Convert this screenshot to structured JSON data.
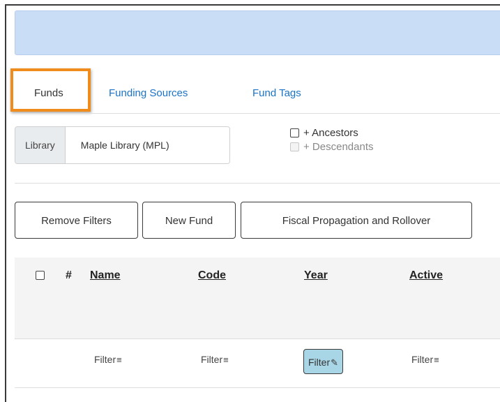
{
  "tabs": [
    {
      "label": "Funds"
    },
    {
      "label": "Funding Sources"
    },
    {
      "label": "Fund Tags"
    }
  ],
  "library_selector": {
    "label": "Library",
    "value": "Maple Library (MPL)",
    "ancestors_label": "+ Ancestors",
    "descendants_label": "+ Descendants"
  },
  "actions": {
    "remove_filters": "Remove Filters",
    "new_fund": "New Fund",
    "fiscal": "Fiscal Propagation and Rollover"
  },
  "grid": {
    "columns": {
      "row_number": "#",
      "name": "Name",
      "code": "Code",
      "year": "Year",
      "active": "Active"
    },
    "filters": {
      "name": "Filter",
      "code": "Filter",
      "year": "Filter",
      "active": "Filter"
    }
  },
  "colors": {
    "banner": "#c9ddf7",
    "tab_link": "#1a73c7",
    "highlight": "#f08c1c",
    "active_filter": "#a9d6e6"
  }
}
